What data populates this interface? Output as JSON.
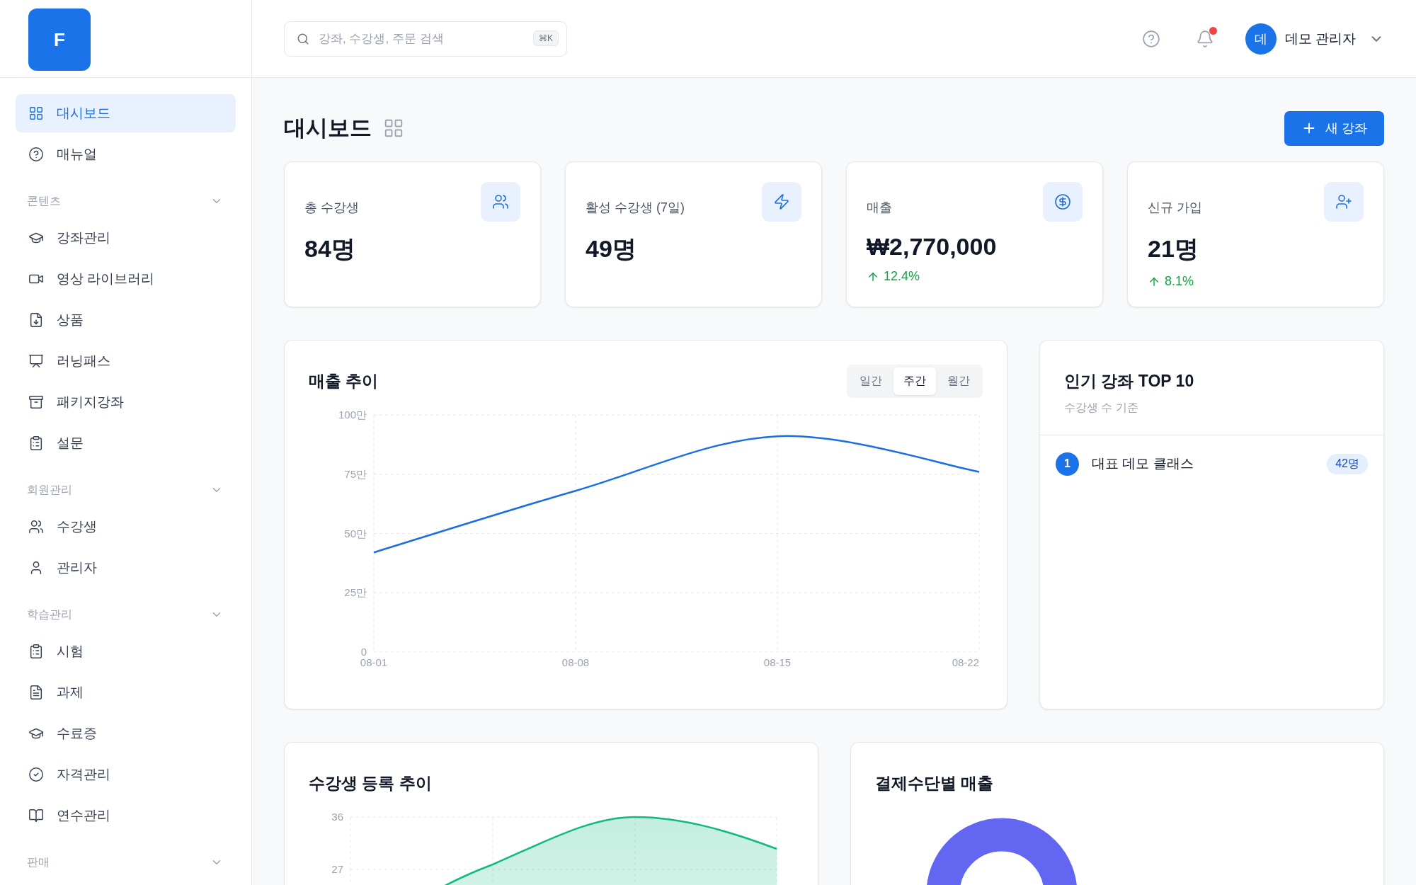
{
  "logo": {
    "letter": "F"
  },
  "sidebar": {
    "items": [
      {
        "label": "대시보드",
        "selected": true
      },
      {
        "label": "매뉴얼",
        "selected": false
      }
    ],
    "sections": [
      {
        "title": "콘텐츠",
        "items": [
          {
            "label": "강좌관리",
            "selected": false
          },
          {
            "label": "영상 라이브러리",
            "selected": false
          },
          {
            "label": "상품",
            "selected": false
          },
          {
            "label": "러닝패스",
            "selected": false
          },
          {
            "label": "패키지강좌",
            "selected": false
          },
          {
            "label": "설문",
            "selected": false
          }
        ]
      },
      {
        "title": "회원관리",
        "items": [
          {
            "label": "수강생",
            "selected": false
          },
          {
            "label": "관리자",
            "selected": false
          }
        ]
      },
      {
        "title": "학습관리",
        "items": [
          {
            "label": "시험",
            "selected": false
          },
          {
            "label": "과제",
            "selected": false
          },
          {
            "label": "수료증",
            "selected": false
          },
          {
            "label": "자격관리",
            "selected": false
          },
          {
            "label": "연수관리",
            "selected": false
          }
        ]
      },
      {
        "title": "판매"
      }
    ]
  },
  "topbar": {
    "search": {
      "placeholder": "강좌, 수강생, 주문 검색",
      "shortcut": "⌘K"
    },
    "notifications": {
      "unread": true
    },
    "user": {
      "avatar": "데",
      "name": "데모 관리자"
    }
  },
  "page": {
    "title": "대시보드",
    "new_button": "새 강좌"
  },
  "stats": [
    {
      "label": "총 수강생",
      "value": "84명"
    },
    {
      "label": "활성 수강생 (7일)",
      "value": "49명"
    },
    {
      "label": "매출",
      "value": "₩2,770,000",
      "delta": "12.4%"
    },
    {
      "label": "신규 가입",
      "value": "21명",
      "delta": "8.1%"
    }
  ],
  "revenue": {
    "title": "매출 추이",
    "tabs": [
      {
        "label": "일간",
        "selected": false
      },
      {
        "label": "주간",
        "selected": true
      },
      {
        "label": "월간",
        "selected": false
      }
    ],
    "chart_data": {
      "type": "line",
      "categories": [
        "08-01",
        "08-08",
        "08-15",
        "08-22"
      ],
      "series": [
        {
          "color": "#1a6fe0",
          "values": [
            42,
            68,
            91,
            76
          ]
        }
      ],
      "ylim": [
        0,
        100
      ],
      "grid": true,
      "yticks": [
        {
          "value": 0,
          "label": "0"
        },
        {
          "value": 25,
          "label": "25만"
        },
        {
          "value": 50,
          "label": "50만"
        },
        {
          "value": 75,
          "label": "75만"
        },
        {
          "value": 100,
          "label": "100만"
        }
      ]
    }
  },
  "top_courses": {
    "title": "인기 강좌 TOP 10",
    "subtitle": "수강생 수 기준",
    "items": [
      {
        "rank": "1",
        "name": "대표 데모 클래스",
        "count": "42명"
      }
    ]
  },
  "enrollment": {
    "title": "수강생 등록 추이",
    "y_labels": [
      "36",
      "27"
    ]
  },
  "payment": {
    "title": "결제수단별 매출",
    "kind": "picture"
  }
}
